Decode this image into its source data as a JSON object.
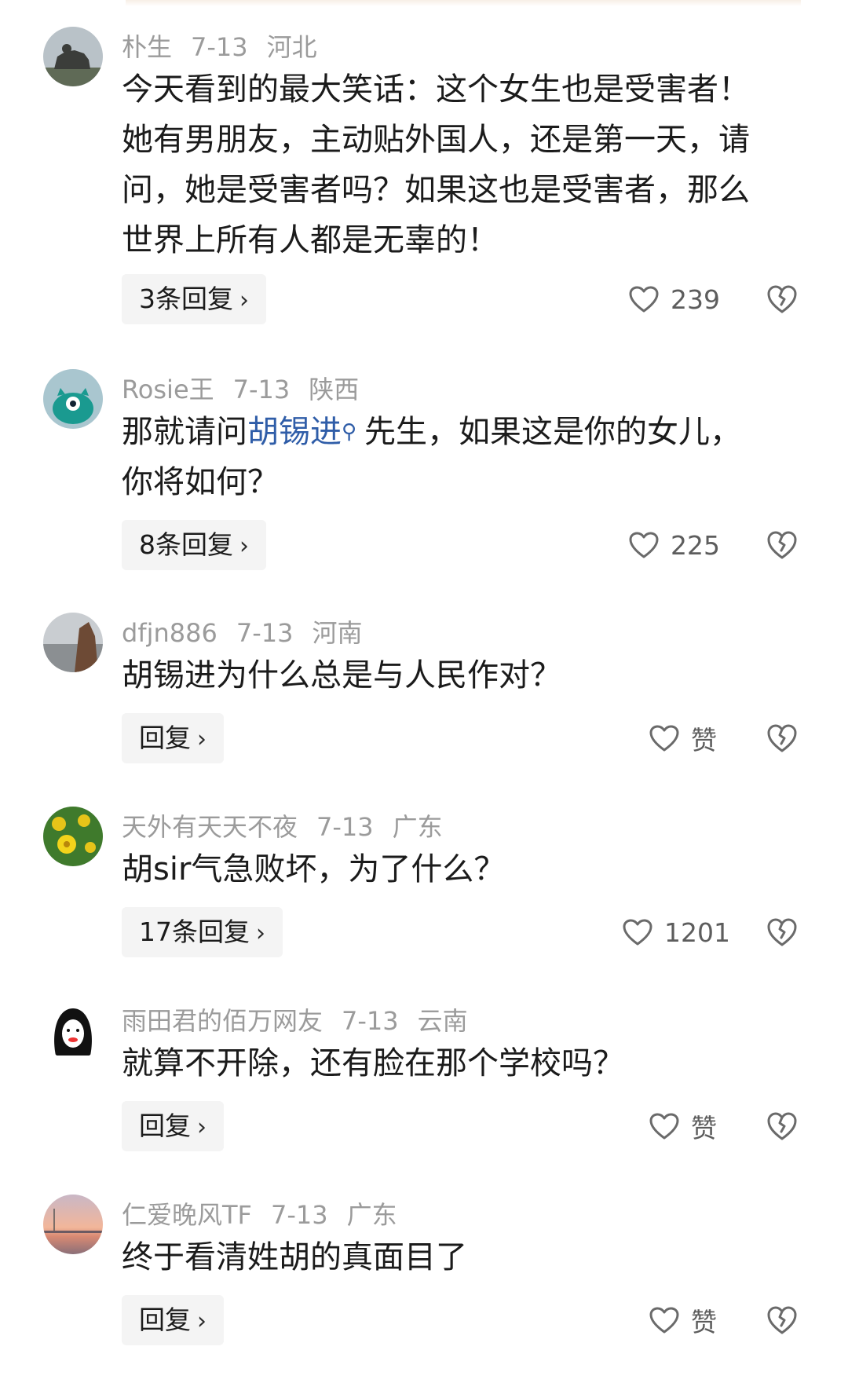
{
  "comments": [
    {
      "username": "朴生",
      "date": "7-13",
      "location": "河北",
      "text_lines": [
        "今天看到的最大笑话：这个女生也是受害者！",
        "她有男朋友，主动贴外国人，还是第一天，请",
        "问，她是受害者吗？如果这也是受害者，那么",
        "世界上所有人都是无辜的！"
      ],
      "reply_label": "3条回复",
      "like_count": "239"
    },
    {
      "username": "Rosie王",
      "date": "7-13",
      "location": "陕西",
      "text_before": "那就请问",
      "text_link": "胡锡进",
      "text_after_line1": "先生，如果这是你的女儿，",
      "text_line2": "你将如何？",
      "reply_label": "8条回复",
      "like_count": "225"
    },
    {
      "username": "dfjn886",
      "date": "7-13",
      "location": "河南",
      "text": "胡锡进为什么总是与人民作对？",
      "reply_label": "回复",
      "like_count": "赞"
    },
    {
      "username": "天外有天天不夜",
      "date": "7-13",
      "location": "广东",
      "text": "胡sir气急败坏，为了什么？",
      "reply_label": "17条回复",
      "like_count": "1201"
    },
    {
      "username": "雨田君的佰万网友",
      "date": "7-13",
      "location": "云南",
      "text": "就算不开除，还有脸在那个学校吗？",
      "reply_label": "回复",
      "like_count": "赞"
    },
    {
      "username": "仁爱晚风TF",
      "date": "7-13",
      "location": "广东",
      "text": "终于看清姓胡的真面目了",
      "reply_label": "回复",
      "like_count": "赞"
    }
  ],
  "icons": {
    "like": "heart-outline-icon",
    "dislike": "broken-heart-icon",
    "chevron": "chevron-right-icon",
    "search_mark": "search-icon"
  },
  "colors": {
    "meta": "#9b9b9b",
    "text": "#1b1b1b",
    "link": "#2f5da8",
    "button_bg": "#f4f4f4"
  }
}
